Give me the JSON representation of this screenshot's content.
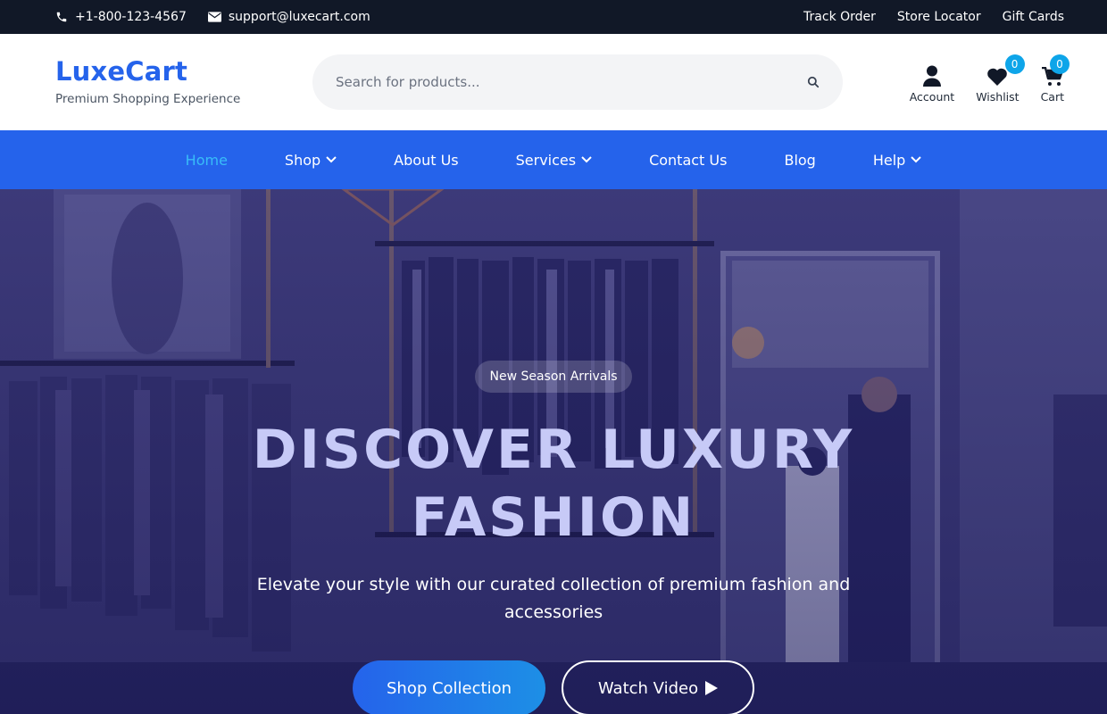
{
  "topbar": {
    "phone": "+1-800-123-4567",
    "email": "support@luxecart.com",
    "links": [
      "Track Order",
      "Store Locator",
      "Gift Cards"
    ]
  },
  "header": {
    "logo": "LuxeCart",
    "tagline": "Premium Shopping Experience",
    "search_placeholder": "Search for products...",
    "actions": {
      "account": "Account",
      "wishlist": "Wishlist",
      "wishlist_count": "0",
      "cart": "Cart",
      "cart_count": "0"
    }
  },
  "nav": {
    "items": [
      {
        "label": "Home",
        "active": true
      },
      {
        "label": "Shop",
        "dropdown": true
      },
      {
        "label": "About Us"
      },
      {
        "label": "Services",
        "dropdown": true
      },
      {
        "label": "Contact Us"
      },
      {
        "label": "Blog"
      },
      {
        "label": "Help",
        "dropdown": true
      }
    ]
  },
  "hero": {
    "badge": "New Season Arrivals",
    "title": "DISCOVER LUXURY FASHION",
    "subtitle": "Elevate your style with our curated collection of premium fashion and accessories",
    "primary_button": "Shop Collection",
    "secondary_button": "Watch Video"
  },
  "colors": {
    "brand": "#2563eb",
    "topbar": "#111827",
    "badge": "#0ea5e9",
    "nav_active": "#38bdf8"
  }
}
